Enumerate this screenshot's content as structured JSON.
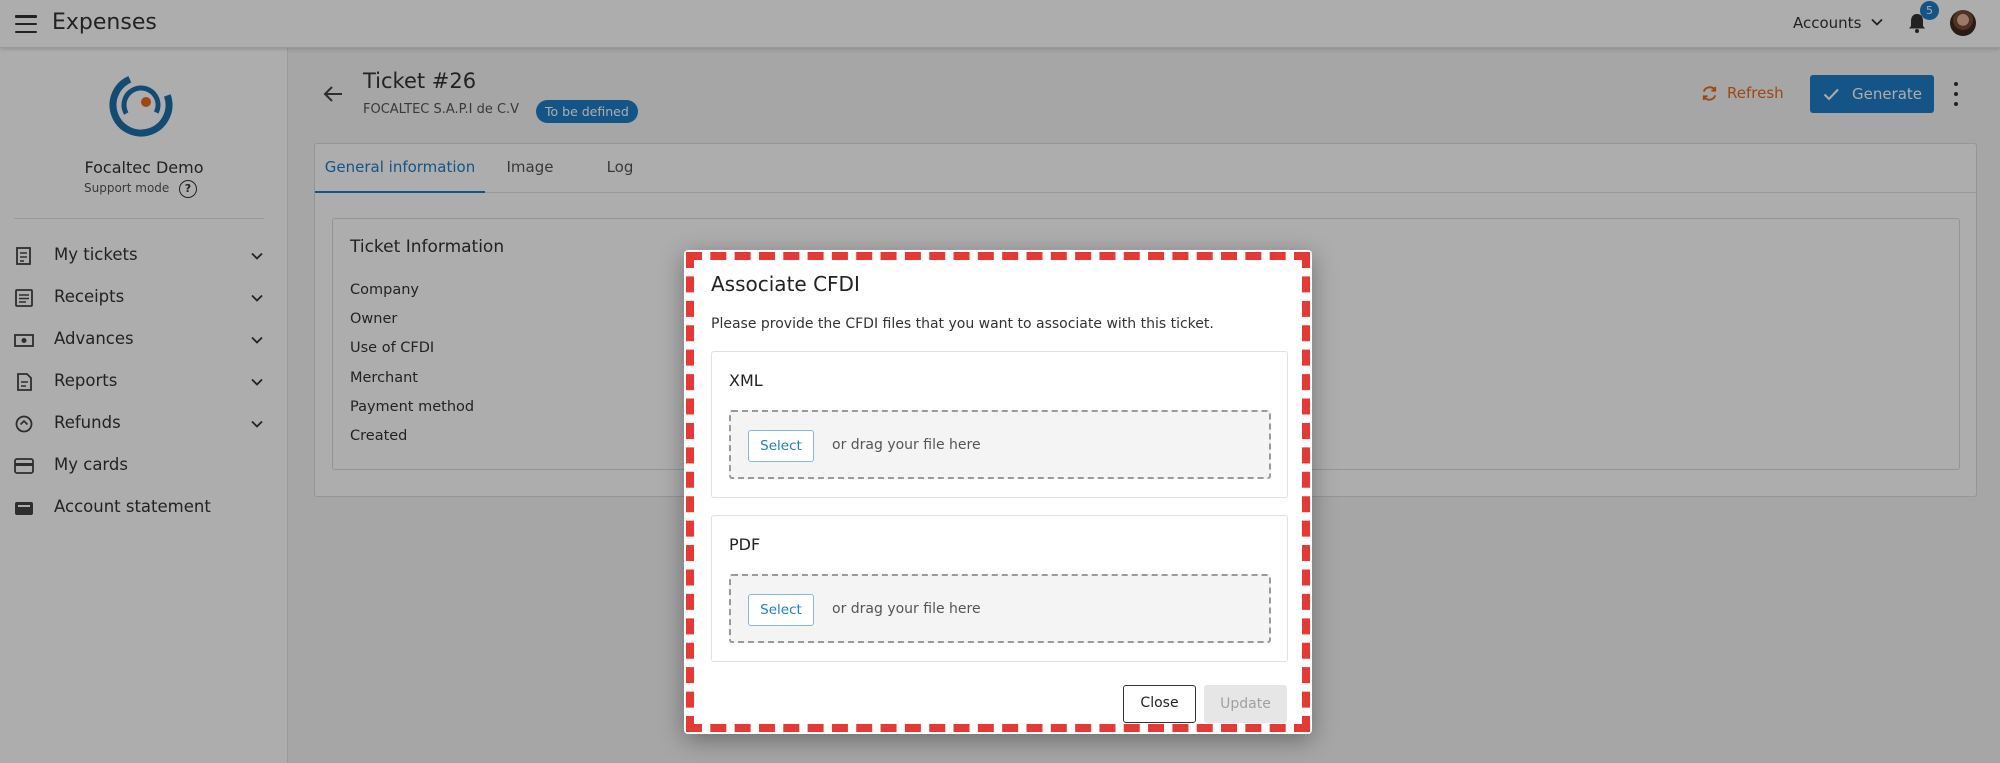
{
  "topbar": {
    "app_title": "Expenses",
    "accounts_label": "Accounts",
    "notification_count": "5"
  },
  "sidebar": {
    "org_name": "Focaltec Demo",
    "support_mode": "Support mode",
    "help_glyph": "?",
    "items": [
      {
        "label": "My tickets",
        "icon": "ticket-icon",
        "expandable": true
      },
      {
        "label": "Receipts",
        "icon": "receipt-icon",
        "expandable": true
      },
      {
        "label": "Advances",
        "icon": "cash-icon",
        "expandable": true
      },
      {
        "label": "Reports",
        "icon": "report-icon",
        "expandable": true
      },
      {
        "label": "Refunds",
        "icon": "refund-icon",
        "expandable": true
      },
      {
        "label": "My cards",
        "icon": "card-icon",
        "expandable": false
      },
      {
        "label": "Account statement",
        "icon": "wallet-icon",
        "expandable": false
      }
    ]
  },
  "ticket": {
    "title": "Ticket #26",
    "company": "FOCALTEC S.A.P.I de C.V",
    "status": "To be defined",
    "refresh_label": "Refresh",
    "generate_label": "Generate"
  },
  "tabs": [
    {
      "label": "General information",
      "active": true
    },
    {
      "label": "Image",
      "active": false
    },
    {
      "label": "Log",
      "active": false
    }
  ],
  "info": {
    "title": "Ticket Information",
    "fields": [
      "Company",
      "Owner",
      "Use of CFDI",
      "Merchant",
      "Payment method",
      "Created"
    ]
  },
  "modal": {
    "title": "Associate CFDI",
    "description": "Please provide the CFDI files that you want to associate with this ticket.",
    "sections": [
      {
        "label": "XML",
        "select_label": "Select",
        "drag_text": "or drag your file here"
      },
      {
        "label": "PDF",
        "select_label": "Select",
        "drag_text": "or drag your file here"
      }
    ],
    "close_label": "Close",
    "update_label": "Update"
  },
  "colors": {
    "primary": "#1e7dc8",
    "accent_orange": "#e66a1f",
    "highlight_red": "#e53935"
  }
}
